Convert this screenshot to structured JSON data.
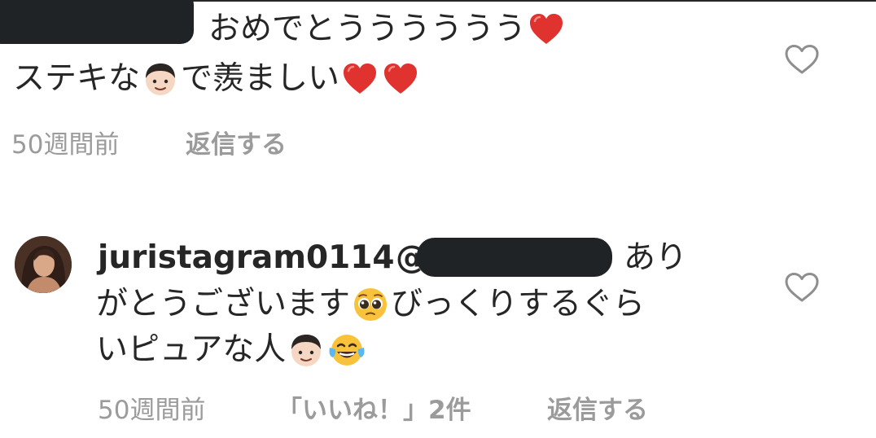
{
  "comment1": {
    "line1": "おめでとうううううう",
    "line2_before": "ステキな",
    "line2_after": "で羨ましい",
    "timestamp": "50週間前",
    "reply": "返信する"
  },
  "comment2": {
    "username": "juristagram0114",
    "mention": "@",
    "line1_tail": "あり",
    "line2_before": "がとうございます",
    "line2_after": "びっくりするぐら",
    "line3": "いピュアな人",
    "timestamp": "50週間前",
    "likes": "「いいね！」2件",
    "reply": "返信する"
  },
  "icons": {
    "like": "heart-outline-icon",
    "heart_emoji": "red-heart-emoji",
    "boy_emoji": "boy-face-emoji",
    "pleading_emoji": "pleading-face-emoji",
    "tears_emoji": "face-with-tears-of-joy-emoji"
  },
  "colors": {
    "text": "#262626",
    "meta": "#9b9b9b",
    "heart": "#e0322f",
    "redaction": "#202326"
  }
}
